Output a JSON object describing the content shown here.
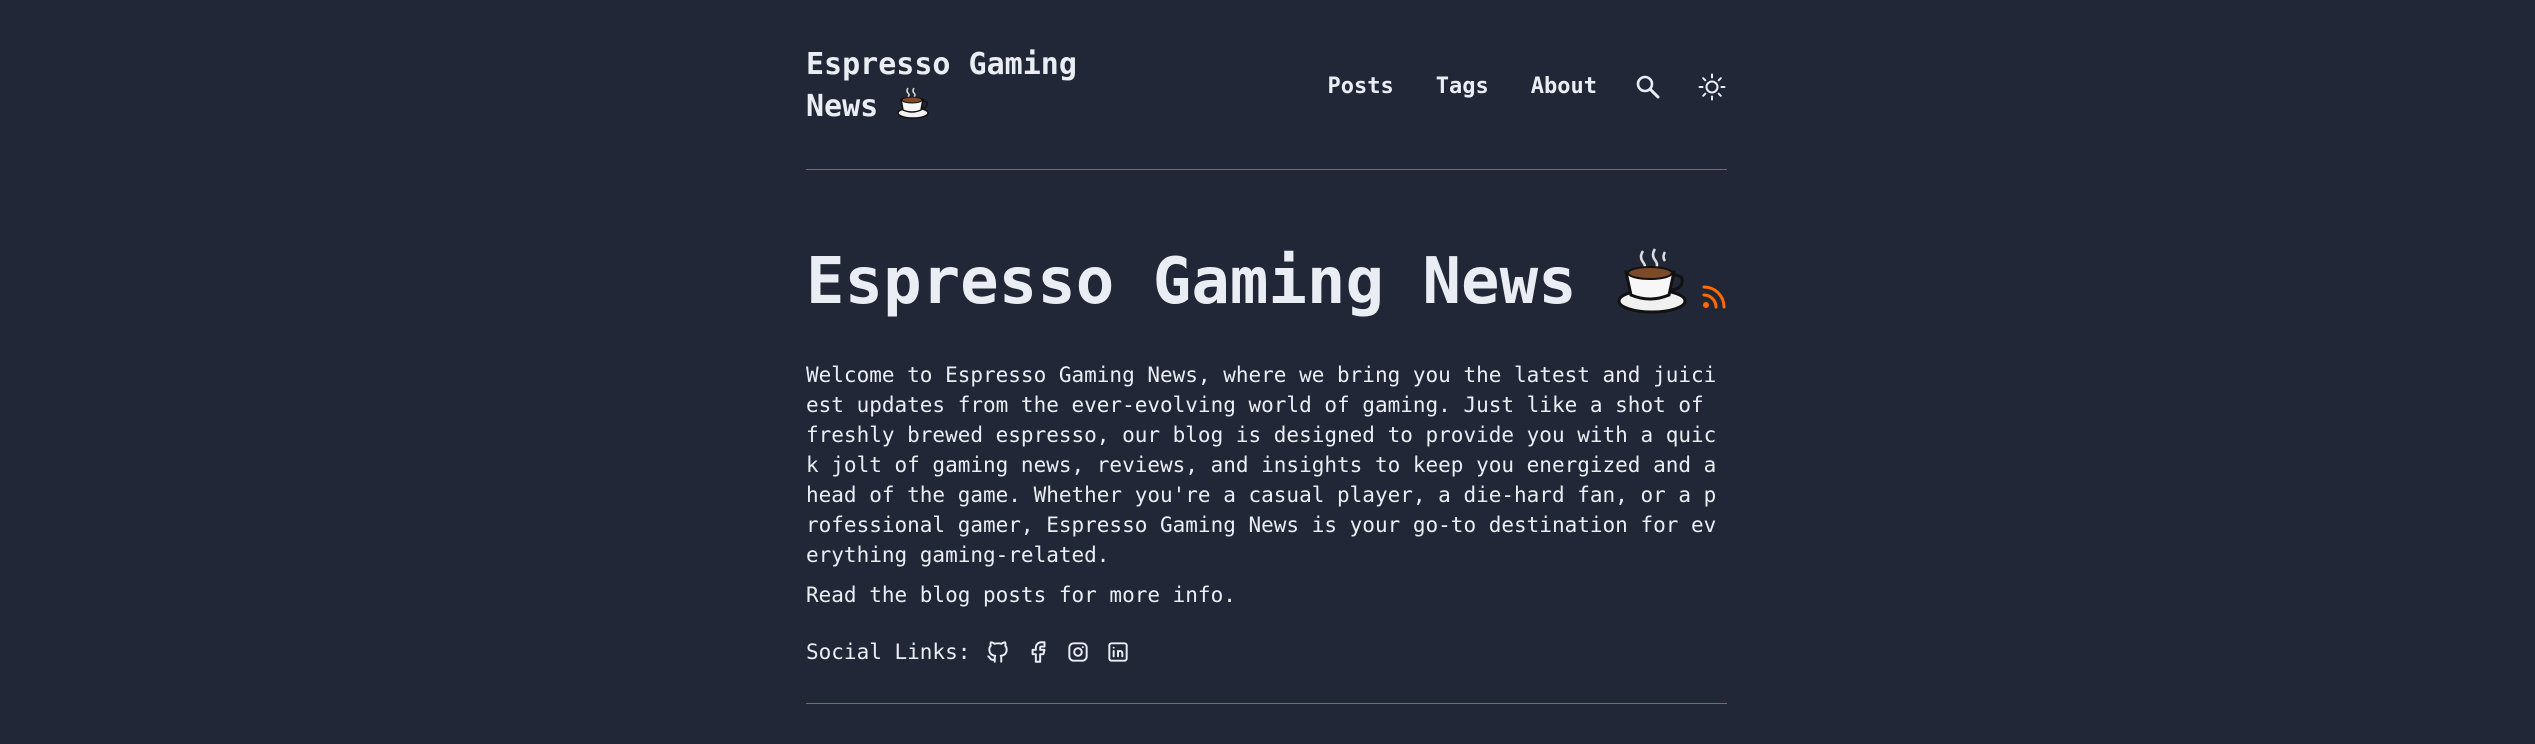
{
  "header": {
    "logo_line1": "Espresso Gaming",
    "logo_line2": "News",
    "logo_emoji": "coffee-cup",
    "nav": [
      {
        "label": "Posts"
      },
      {
        "label": "Tags"
      },
      {
        "label": "About"
      }
    ],
    "search_icon": "search-icon",
    "theme_icon": "sun-icon"
  },
  "hero": {
    "title": "Espresso Gaming News",
    "title_emoji": "coffee-cup",
    "rss_icon": "rss-icon",
    "intro": "Welcome to Espresso Gaming News, where we bring you the latest and juiciest updates from the ever-evolving world of gaming. Just like a shot of freshly brewed espresso, our blog is designed to provide you with a quick jolt of gaming news, reviews, and insights to keep you energized and ahead of the game. Whether you're a casual player, a die-hard fan, or a professional gamer, Espresso Gaming News is your go-to destination for everything gaming-related.",
    "read_more": "Read the blog posts for more info.",
    "social_label": "Social Links:",
    "social_icons": [
      "github-icon",
      "facebook-icon",
      "instagram-icon",
      "linkedin-icon"
    ]
  },
  "colors": {
    "background": "#212737",
    "text": "#eaedf3",
    "accent": "#ff6b01",
    "rule": "#b5562b"
  }
}
